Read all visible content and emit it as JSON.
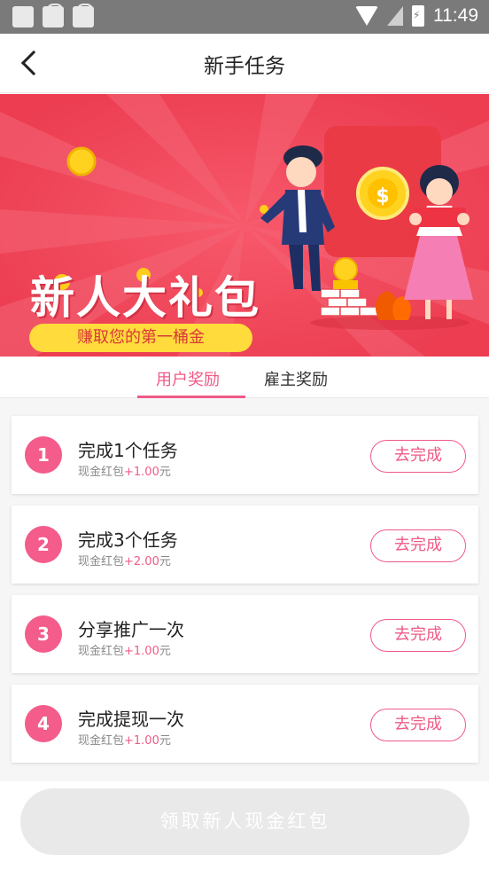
{
  "status_bar": {
    "time": "11:49",
    "icons": [
      "app-icon",
      "bag-icon",
      "bag-icon",
      "wifi-icon",
      "no-sim-icon",
      "battery-charging-icon"
    ]
  },
  "header": {
    "title": "新手任务",
    "back_icon": "chevron-left-icon"
  },
  "banner": {
    "title": "新人大礼包",
    "subtitle": "赚取您的第一桶金",
    "coin_symbol": "$"
  },
  "tabs": [
    {
      "label": "用户奖励",
      "active": true
    },
    {
      "label": "雇主奖励",
      "active": false
    }
  ],
  "tasks": [
    {
      "number": "1",
      "title": "完成1个任务",
      "reward_prefix": "现金红包",
      "reward_amount": "+1.00",
      "reward_unit": "元",
      "button": "去完成"
    },
    {
      "number": "2",
      "title": "完成3个任务",
      "reward_prefix": "现金红包",
      "reward_amount": "+2.00",
      "reward_unit": "元",
      "button": "去完成"
    },
    {
      "number": "3",
      "title": "分享推广一次",
      "reward_prefix": "现金红包",
      "reward_amount": "+1.00",
      "reward_unit": "元",
      "button": "去完成"
    },
    {
      "number": "4",
      "title": "完成提现一次",
      "reward_prefix": "现金红包",
      "reward_amount": "+1.00",
      "reward_unit": "元",
      "button": "去完成"
    }
  ],
  "footer": {
    "claim_button": "领取新人现金红包",
    "claim_enabled": false
  },
  "colors": {
    "accent": "#f05a86",
    "banner_red": "#f0475a",
    "banner_yellow": "#ffdb3b"
  }
}
